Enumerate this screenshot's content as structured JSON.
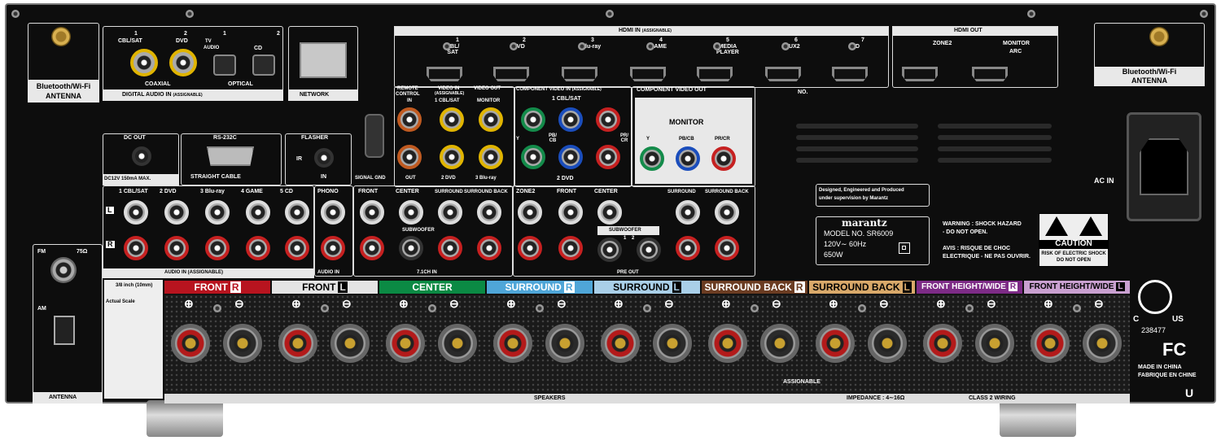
{
  "bt_left": {
    "line1": "Bluetooth/Wi-Fi",
    "line2": "ANTENNA"
  },
  "bt_right": {
    "line1": "Bluetooth/Wi-Fi",
    "line2": "ANTENNA"
  },
  "digital_audio": {
    "n1": "1",
    "cbl": "CBL/SAT",
    "n2": "2",
    "dvd": "DVD",
    "n1b": "1",
    "tv": "TV",
    "audio": "AUDIO",
    "n2b": "2",
    "cd": "CD",
    "coaxial": "COAXIAL",
    "optical": "OPTICAL",
    "title": "DIGITAL AUDIO IN",
    "assignable": "(ASSIGNABLE)"
  },
  "network": "NETWORK",
  "hdmi_in": {
    "title": "HDMI IN",
    "assignable": "(ASSIGNABLE)",
    "ports": [
      {
        "num": "1",
        "name": "CBL/\nSAT"
      },
      {
        "num": "2",
        "name": "DVD"
      },
      {
        "num": "3",
        "name": "Blu-ray"
      },
      {
        "num": "4",
        "name": "GAME"
      },
      {
        "num": "5",
        "name": "MEDIA\nPLAYER"
      },
      {
        "num": "6",
        "name": "AUX2"
      },
      {
        "num": "7",
        "name": "CD"
      }
    ]
  },
  "hdmi_out": {
    "title": "HDMI OUT",
    "zone2": "ZONE2",
    "monitor": "MONITOR",
    "arc": "ARC",
    "no": "NO."
  },
  "remote_control": {
    "title1": "REMOTE",
    "title2": "CONTROL",
    "in": "IN",
    "out": "OUT"
  },
  "video_in": {
    "title": "VIDEO IN",
    "assignable": "(ASSIGNABLE)",
    "cbl": "1 CBL/SAT",
    "dvd": "2 DVD",
    "bluray": "3 Blu-ray"
  },
  "video_out": {
    "title": "VIDEO OUT",
    "monitor": "MONITOR"
  },
  "component_in": {
    "title": "COMPONENT VIDEO IN",
    "assignable": "(ASSIGNABLE)",
    "cbl": "1 CBL/SAT",
    "dvd": "2 DVD",
    "y": "Y",
    "pb": "PB/\nCB",
    "pr": "PR/\nCR"
  },
  "component_out": {
    "title": "COMPONENT VIDEO OUT",
    "monitor": "MONITOR",
    "y": "Y",
    "pb": "PB/CB",
    "pr": "PR/CR"
  },
  "signal_gnd": "SIGNAL GND",
  "dc_out": {
    "title": "DC OUT",
    "spec": "DC12V 150mA MAX."
  },
  "rs232c": {
    "title": "RS-232C",
    "cable": "STRAIGHT CABLE"
  },
  "flasher": {
    "title": "FLASHER",
    "ir": "IR",
    "in": "IN"
  },
  "audio_in": {
    "cols": [
      "1 CBL/SAT",
      "2 DVD",
      "3 Blu-ray",
      "4 GAME",
      "5 CD"
    ],
    "l": "L",
    "r": "R",
    "title": "AUDIO IN",
    "assignable": "(ASSIGNABLE)"
  },
  "phono": {
    "title": "PHONO",
    "footer": "AUDIO IN"
  },
  "ch71": {
    "front": "FRONT",
    "center": "CENTER",
    "surround": "SURROUND",
    "surround_back": "SURROUND BACK",
    "subwoofer": "SUBWOOFER",
    "footer": "7.1CH IN"
  },
  "pre_out": {
    "zone2": "ZONE2",
    "front": "FRONT",
    "center": "CENTER",
    "surround": "SURROUND",
    "surround_back": "SURROUND BACK",
    "subwoofer": "SUBWOOFER",
    "sub1": "1",
    "sub2": "2",
    "footer": "PRE OUT"
  },
  "designed": {
    "line1": "Designed, Engineered and Produced",
    "line2": "under supervision by Marantz"
  },
  "model": {
    "brand": "marantz",
    "model": "MODEL NO. SR6009",
    "power": "120V∼ 60Hz",
    "watts": "650W"
  },
  "warning": {
    "l1": "WARNING : SHOCK HAZARD",
    "l2": "- DO NOT OPEN.",
    "l3": "AVIS : RISQUE DE CHOC",
    "l4": "ELECTRIQUE - NE PAS OUVRIR."
  },
  "caution": {
    "title": "CAUTION",
    "l1": "RISK OF ELECTRIC SHOCK",
    "l2": "DO NOT OPEN"
  },
  "ac_in": "AC IN",
  "cert": {
    "c": "C",
    "us": "US",
    "num": "238477",
    "fc": "FC",
    "made1": "MADE IN CHINA",
    "made2": "FABRIQUE EN CHINE",
    "u": "U"
  },
  "antenna": {
    "fm": "FM",
    "ohm": "75Ω",
    "am": "AM",
    "footer": "ANTENNA"
  },
  "strip": {
    "l1": "3/8 inch (10mm)",
    "l2": "Actual Scale"
  },
  "speakers": [
    {
      "name": "FRONT",
      "side": "R",
      "bg": "#b8141f",
      "fg": "#ffffff"
    },
    {
      "name": "FRONT",
      "side": "L",
      "bg": "#e4e4e4",
      "fg": "#000000"
    },
    {
      "name": "CENTER",
      "side": "",
      "bg": "#0b8a44",
      "fg": "#ffffff"
    },
    {
      "name": "SURROUND",
      "side": "R",
      "bg": "#4fa6d8",
      "fg": "#ffffff"
    },
    {
      "name": "SURROUND",
      "side": "L",
      "bg": "#a9cfe8",
      "fg": "#000000"
    },
    {
      "name": "SURROUND BACK",
      "side": "R",
      "bg": "#6b3c22",
      "fg": "#ffffff"
    },
    {
      "name": "SURROUND BACK",
      "side": "L",
      "bg": "#d9a96a",
      "fg": "#000000"
    },
    {
      "name": "FRONT HEIGHT/WIDE",
      "side": "R",
      "bg": "#7d2b86",
      "fg": "#ffffff"
    },
    {
      "name": "FRONT HEIGHT/WIDE",
      "side": "L",
      "bg": "#c9a0d0",
      "fg": "#000000"
    }
  ],
  "speaker_footer": {
    "speakers": "SPEAKERS",
    "assignable": "ASSIGNABLE",
    "impedance": "IMPEDANCE : 4∼16Ω",
    "class2": "CLASS 2 WIRING"
  },
  "plus": "⊕",
  "minus": "⊖"
}
